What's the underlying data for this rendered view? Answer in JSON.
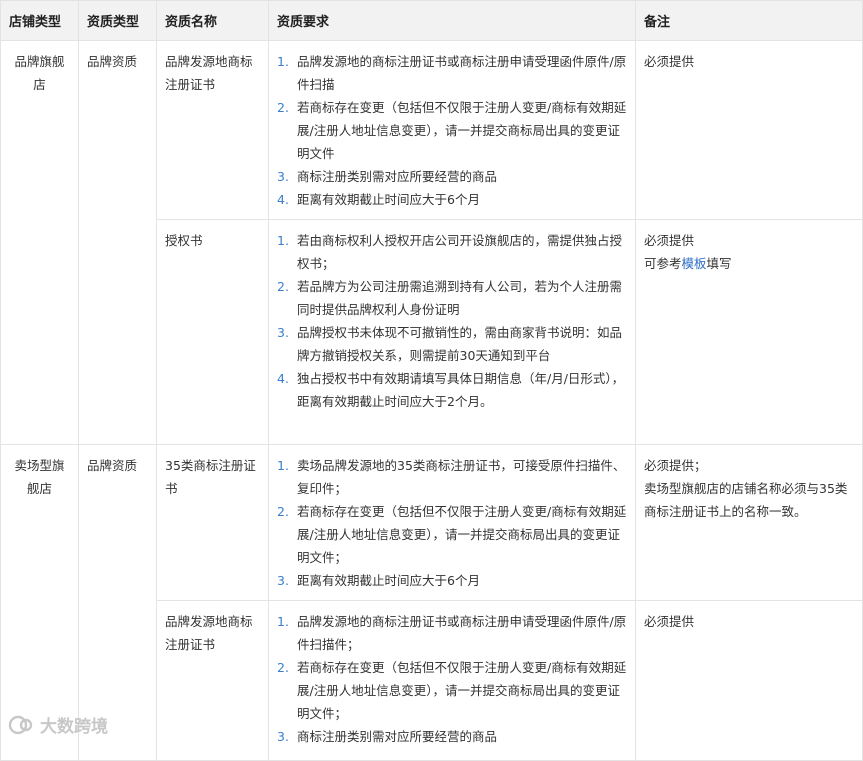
{
  "headers": [
    "店铺类型",
    "资质类型",
    "资质名称",
    "资质要求",
    "备注"
  ],
  "groups": [
    {
      "shop_type": "品牌旗舰店",
      "qual_type": "品牌资质",
      "rows": [
        {
          "name": "品牌发源地商标注册证书",
          "requirements": [
            "品牌发源地的商标注册证书或商标注册申请受理函件原件/原件扫描",
            "若商标存在变更（包括但不仅限于注册人变更/商标有效期延展/注册人地址信息变更），请一并提交商标局出具的变更证明文件",
            "商标注册类别需对应所要经营的商品",
            "距离有效期截止时间应大于6个月"
          ],
          "note": "必须提供"
        },
        {
          "name": "授权书",
          "requirements": [
            "若由商标权利人授权开店公司开设旗舰店的，需提供独占授权书；",
            "若品牌方为公司注册需追溯到持有人公司，若为个人注册需同时提供品牌权利人身份证明",
            "品牌授权书未体现不可撤销性的，需由商家背书说明：如品牌方撤销授权关系，则需提前30天通知到平台",
            "独占授权书中有效期请填写具体日期信息（年/月/日形式），距离有效期截止时间应大于2个月。"
          ],
          "note": "必须提供",
          "note_line2_prefix": "可参考",
          "note_link": "模板",
          "note_line2_suffix": "填写"
        }
      ]
    },
    {
      "shop_type": "卖场型旗舰店",
      "qual_type": "品牌资质",
      "rows": [
        {
          "name": "35类商标注册证书",
          "requirements": [
            "卖场品牌发源地的35类商标注册证书，可接受原件扫描件、复印件；",
            "若商标存在变更（包括但不仅限于注册人变更/商标有效期延展/注册人地址信息变更），请一并提交商标局出具的变更证明文件；",
            "距离有效期截止时间应大于6个月"
          ],
          "note": "必须提供；",
          "note_line2": "卖场型旗舰店的店铺名称必须与35类商标注册证书上的名称一致。"
        },
        {
          "name": "品牌发源地商标注册证书",
          "requirements": [
            "品牌发源地的商标注册证书或商标注册申请受理函件原件/原件扫描件；",
            "若商标存在变更（包括但不仅限于注册人变更/商标有效期延展/注册人地址信息变更），请一并提交商标局出具的变更证明文件；",
            "商标注册类别需对应所要经营的商品"
          ],
          "note": "必须提供"
        }
      ]
    }
  ],
  "watermark": "大数跨境",
  "colors": {
    "header_bg": "#f2f2f2",
    "border": "#e3e3e3",
    "link": "#2e6fc4",
    "number": "#3b7fcc"
  }
}
